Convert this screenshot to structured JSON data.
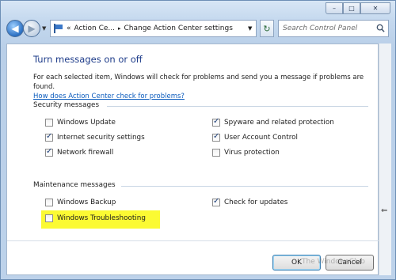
{
  "window": {
    "controls": {
      "minimize": "–",
      "maximize": "□",
      "close": "✕"
    }
  },
  "navbar": {
    "back_icon": "back-arrow",
    "forward_icon": "forward-arrow",
    "breadcrumbs": [
      "«",
      "Action Ce...",
      "Change Action Center settings"
    ],
    "search_placeholder": "Search Control Panel"
  },
  "page": {
    "title": "Turn messages on or off",
    "description": "For each selected item, Windows will check for problems and send you a message if problems are found.",
    "help_link": "How does Action Center check for problems?"
  },
  "security": {
    "label": "Security messages",
    "items": [
      {
        "label": "Windows Update",
        "checked": false
      },
      {
        "label": "Spyware and related protection",
        "checked": true
      },
      {
        "label": "Internet security settings",
        "checked": true
      },
      {
        "label": "User Account Control",
        "checked": true
      },
      {
        "label": "Network firewall",
        "checked": true
      },
      {
        "label": "Virus protection",
        "checked": false
      }
    ]
  },
  "maintenance": {
    "label": "Maintenance messages",
    "items": [
      {
        "label": "Windows Backup",
        "checked": false
      },
      {
        "label": "Check for updates",
        "checked": true
      },
      {
        "label": "Windows Troubleshooting",
        "checked": false
      }
    ]
  },
  "buttons": {
    "ok": "OK",
    "cancel": "Cancel"
  },
  "watermark": "The WindowsClub",
  "colors": {
    "title": "#1e3c8a",
    "link": "#0b5bbd",
    "highlight": "#fbfa33"
  }
}
